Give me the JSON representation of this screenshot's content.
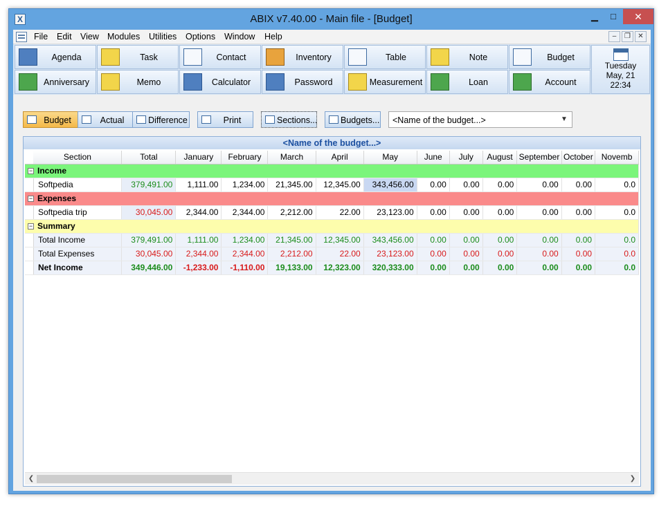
{
  "window": {
    "title": "ABIX v7.40.00  -  Main file - [Budget]",
    "app_icon": "X",
    "min_symbol": "▁",
    "max_symbol": "□",
    "close_symbol": "✕"
  },
  "menu": {
    "items": [
      "File",
      "Edit",
      "View",
      "Modules",
      "Utilities",
      "Options",
      "Window",
      "Help"
    ],
    "mdi_min": "–",
    "mdi_restore": "❐",
    "mdi_close": "✕"
  },
  "toolbar": {
    "row1": [
      {
        "label": "Agenda",
        "icon": "agenda-icon"
      },
      {
        "label": "Task",
        "icon": "task-icon"
      },
      {
        "label": "Contact",
        "icon": "contact-icon"
      },
      {
        "label": "Inventory",
        "icon": "inventory-icon"
      },
      {
        "label": "Table",
        "icon": "table-icon"
      },
      {
        "label": "Note",
        "icon": "note-icon"
      },
      {
        "label": "Budget",
        "icon": "budget-icon"
      }
    ],
    "row2": [
      {
        "label": "Anniversary",
        "icon": "anniversary-icon"
      },
      {
        "label": "Memo",
        "icon": "memo-icon"
      },
      {
        "label": "Calculator",
        "icon": "calculator-icon"
      },
      {
        "label": "Password",
        "icon": "password-icon"
      },
      {
        "label": "Measurement",
        "icon": "measurement-icon"
      },
      {
        "label": "Loan",
        "icon": "loan-icon"
      },
      {
        "label": "Account",
        "icon": "account-icon"
      }
    ],
    "date": {
      "day": "Tuesday",
      "date": "May, 21",
      "time": "22:34"
    }
  },
  "subbar": {
    "budget": "Budget",
    "actual": "Actual",
    "difference": "Difference",
    "print": "Print",
    "sections": "Sections...",
    "budgets": "Budgets...",
    "selected_budget": "<Name of the budget...>",
    "dropdown_arrow": "⌵"
  },
  "panel": {
    "header": "<Name of the budget...>"
  },
  "grid": {
    "columns": [
      "Section",
      "Total",
      "January",
      "February",
      "March",
      "April",
      "May",
      "June",
      "July",
      "August",
      "September",
      "October",
      "Novemb"
    ],
    "groups": {
      "income": {
        "label": "Income",
        "toggle": "−"
      },
      "expenses": {
        "label": "Expenses",
        "toggle": "−"
      },
      "summary": {
        "label": "Summary",
        "toggle": "−"
      }
    },
    "rows": {
      "softpedia": {
        "name": "Softpedia",
        "values": [
          "379,491.00",
          "1,111.00",
          "1,234.00",
          "21,345.00",
          "12,345.00",
          "343,456.00",
          "0.00",
          "0.00",
          "0.00",
          "0.00",
          "0.00",
          "0.0"
        ]
      },
      "softpedia_trip": {
        "name": "Softpedia trip",
        "values": [
          "30,045.00",
          "2,344.00",
          "2,344.00",
          "2,212.00",
          "22.00",
          "23,123.00",
          "0.00",
          "0.00",
          "0.00",
          "0.00",
          "0.00",
          "0.0"
        ]
      },
      "total_income": {
        "name": "Total Income",
        "values": [
          "379,491.00",
          "1,111.00",
          "1,234.00",
          "21,345.00",
          "12,345.00",
          "343,456.00",
          "0.00",
          "0.00",
          "0.00",
          "0.00",
          "0.00",
          "0.0"
        ]
      },
      "total_expenses": {
        "name": "Total Expenses",
        "values": [
          "30,045.00",
          "2,344.00",
          "2,344.00",
          "2,212.00",
          "22.00",
          "23,123.00",
          "0.00",
          "0.00",
          "0.00",
          "0.00",
          "0.00",
          "0.0"
        ]
      },
      "net_income": {
        "name": "Net Income",
        "values": [
          "349,446.00",
          "-1,233.00",
          "-1,110.00",
          "19,133.00",
          "12,323.00",
          "320,333.00",
          "0.00",
          "0.00",
          "0.00",
          "0.00",
          "0.00",
          "0.0"
        ]
      }
    }
  },
  "scrollbar": {
    "left": "❮",
    "right": "❯"
  },
  "colors": {
    "income_row": "#7bf57b",
    "expenses_row": "#fa8a8a",
    "summary_row": "#fdfdac",
    "positive": "#1b8c1b",
    "negative": "#d81a1a",
    "active_tab": "#f4b94a"
  }
}
